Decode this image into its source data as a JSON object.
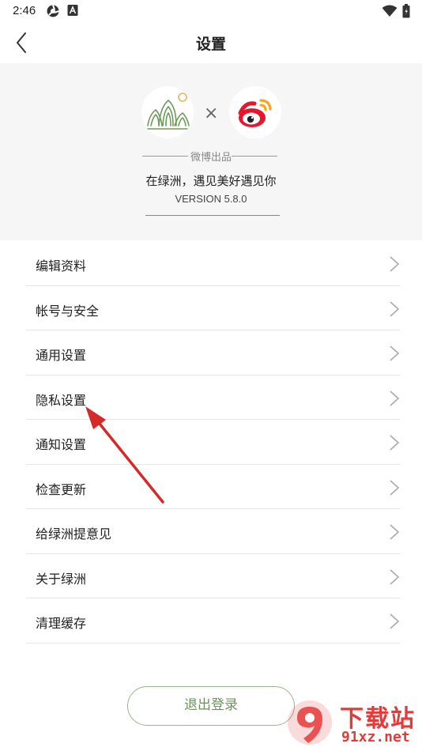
{
  "status_bar": {
    "time": "2:46"
  },
  "nav": {
    "title": "设置"
  },
  "banner": {
    "times_sign": "×",
    "produced_by": "微博出品",
    "slogan": "在绿洲，遇见美好遇见你",
    "version": "VERSION 5.8.0"
  },
  "menu": {
    "items": [
      {
        "label": "编辑资料"
      },
      {
        "label": "帐号与安全"
      },
      {
        "label": "通用设置"
      },
      {
        "label": "隐私设置"
      },
      {
        "label": "通知设置"
      },
      {
        "label": "检查更新"
      },
      {
        "label": "给绿洲提意见"
      },
      {
        "label": "关于绿洲"
      },
      {
        "label": "清理缓存"
      }
    ]
  },
  "logout": {
    "label": "退出登录"
  },
  "watermark": {
    "text": "下载站",
    "url": "91xz.net"
  },
  "colors": {
    "accent": "#6e9160",
    "arrow": "#d42a2a",
    "watermark": "#e63a3a"
  }
}
